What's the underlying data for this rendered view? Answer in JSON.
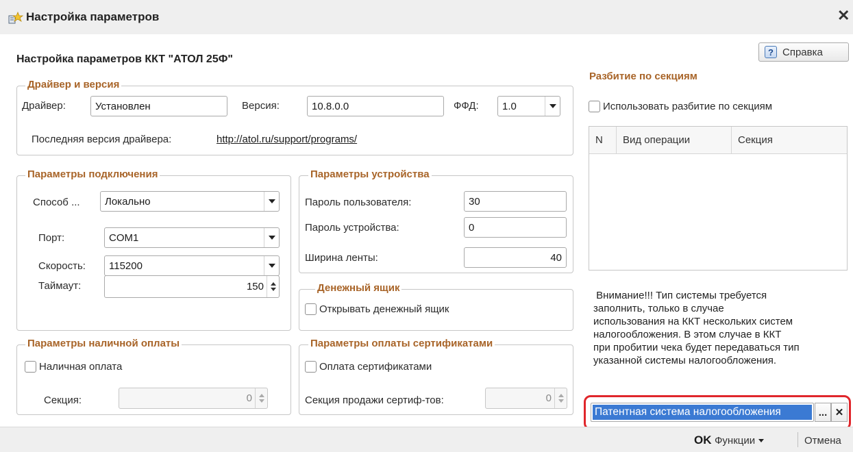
{
  "window": {
    "title": "Настройка параметров",
    "close_glyph": "✕"
  },
  "form_title": "Настройка параметров ККТ \"АТОЛ 25Ф\"",
  "help_button": {
    "icon_glyph": "?",
    "label": "Справка"
  },
  "driver_group": {
    "legend": "Драйвер и версия",
    "driver_label": "Драйвер:",
    "driver_value": "Установлен",
    "version_label": "Версия:",
    "version_value": "10.8.0.0",
    "ffd_label": "ФФД:",
    "ffd_value": "1.0",
    "latest_label": "Последняя версия драйвера:",
    "latest_link": "http://atol.ru/support/programs/"
  },
  "connection_group": {
    "legend": "Параметры подключения",
    "method_label": "Способ ...",
    "method_value": "Локально",
    "port_label": "Порт:",
    "port_value": "COM1",
    "speed_label": "Скорость:",
    "speed_value": "115200",
    "timeout_label": "Таймаут:",
    "timeout_value": "150"
  },
  "device_group": {
    "legend": "Параметры устройства",
    "user_password_label": "Пароль пользователя:",
    "user_password_value": "30",
    "device_password_label": "Пароль устройства:",
    "device_password_value": "0",
    "tape_width_label": "Ширина ленты:",
    "tape_width_value": "40"
  },
  "cash_drawer_group": {
    "legend": "Денежный ящик",
    "open_drawer_label": "Открывать денежный ящик"
  },
  "cash_payment_group": {
    "legend": "Параметры наличной оплаты",
    "cash_payment_label": "Наличная оплата",
    "section_label": "Секция:",
    "section_value": "0"
  },
  "certificate_group": {
    "legend": "Параметры оплаты сертификатами",
    "certificate_payment_label": "Оплата сертификатами",
    "section_label": "Секция продажи сертиф-тов:",
    "section_value": "0"
  },
  "sections_panel": {
    "title": "Разбитие по секциям",
    "use_sections_label": "Использовать разбитие по секциям",
    "columns": [
      "N",
      "Вид операции",
      "Секция"
    ],
    "note_lines": [
      " Внимание!!! Тип системы требуется",
      "заполнить, только в случае",
      "использования на ККТ нескольких систем",
      "налогообложения. В этом случае в ККТ",
      "при пробитии чека будет передаваться тип",
      "указанной системы налогообложения."
    ],
    "tax_system_value": "Патентная система налогообложения",
    "select_button": "...",
    "clear_button": "✕"
  },
  "footer": {
    "ok_label": "OK",
    "functions_label": "Функции",
    "cancel_label": "Отмена"
  },
  "colors": {
    "legend": "#a86428",
    "selection": "#3b7ad3",
    "highlight_outline": "#e0262b"
  }
}
